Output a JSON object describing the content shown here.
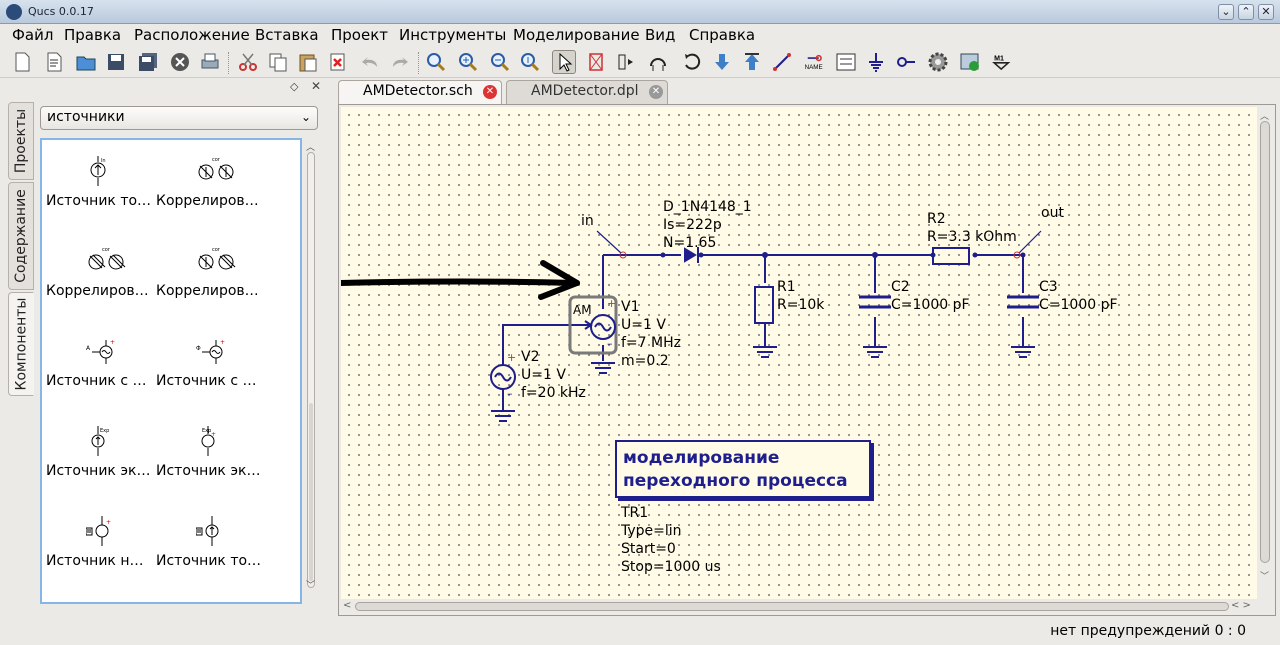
{
  "window": {
    "title": "Qucs 0.0.17",
    "controls": [
      "⌄",
      "⌃",
      "✕"
    ]
  },
  "menubar": {
    "items": [
      {
        "label": "Файл"
      },
      {
        "label": "Правка"
      },
      {
        "label": "Расположение"
      },
      {
        "label": "Вставка"
      },
      {
        "label": "Проект"
      },
      {
        "label": "Инструменты"
      },
      {
        "label": "Моделирование"
      },
      {
        "label": "Вид"
      },
      {
        "label": "Справка"
      }
    ]
  },
  "toolbar": {
    "icons": [
      "new-file-icon",
      "new-text-icon",
      "open-icon",
      "save-icon",
      "save-all-icon",
      "close-file-icon",
      "print-icon",
      "cut-icon",
      "copy-icon",
      "paste-icon",
      "delete-icon",
      "undo-icon",
      "redo-icon",
      "zoom-fit-icon",
      "zoom-in-icon",
      "zoom-out-icon",
      "zoom-1-icon",
      "select-icon",
      "deactivate-icon",
      "mirror-icon",
      "rotate-label-icon",
      "rotate-icon",
      "move-down-icon",
      "move-up-icon",
      "wire-icon",
      "name-icon",
      "equation-icon",
      "ground-icon",
      "port-icon",
      "simulate-icon",
      "display-icon",
      "marker-icon"
    ],
    "name_label": "NAME",
    "marker_label": "M1"
  },
  "dock": {
    "vertical_tabs": [
      {
        "label": "Проекты"
      },
      {
        "label": "Содержание"
      },
      {
        "label": "Компоненты"
      }
    ],
    "category": "источники",
    "components": [
      {
        "label": "Источник то…",
        "icon": "dc-current-source-icon"
      },
      {
        "label": "Коррелиров…",
        "icon": "correlated-current-source-icon"
      },
      {
        "label": "Коррелиров…",
        "icon": "correlated-voltage-source-icon"
      },
      {
        "label": "Коррелиров…",
        "icon": "correlated-mixed-source-icon"
      },
      {
        "label": "Источник с …",
        "icon": "am-source-icon"
      },
      {
        "label": "Источник с …",
        "icon": "pm-source-icon"
      },
      {
        "label": "Источник эк…",
        "icon": "exp-current-source-icon"
      },
      {
        "label": "Источник эк…",
        "icon": "exp-voltage-source-icon"
      },
      {
        "label": "Источник н…",
        "icon": "file-voltage-source-icon"
      },
      {
        "label": "Источник то…",
        "icon": "file-current-source-icon"
      }
    ]
  },
  "tabs": [
    {
      "label": "AMDetector.sch",
      "active": true
    },
    {
      "label": "AMDetector.dpl",
      "active": false
    }
  ],
  "schematic": {
    "labels": {
      "in": "in",
      "out": "out",
      "diode": [
        "D_1N4148_1",
        "Is=222p",
        "N=1.65"
      ],
      "r1": [
        "R1",
        "R=10k"
      ],
      "r2": [
        "R2",
        "R=3.3 kOhm"
      ],
      "c2": [
        "C2",
        "C=1000 pF"
      ],
      "c3": [
        "C3",
        "C=1000 pF"
      ],
      "v1": [
        "V1",
        "U=1 V",
        "f=7 MHz",
        "m=0.2"
      ],
      "v1_tag": "AM",
      "v2": [
        "V2",
        "U=1 V",
        "f=20 kHz"
      ],
      "sim_title": [
        "моделирование",
        "переходного процесса"
      ],
      "sim_params": [
        "TR1",
        "Type=lin",
        "Start=0",
        "Stop=1000 us"
      ]
    }
  },
  "status": {
    "text": "нет предупреждений 0 : 0"
  },
  "colors": {
    "wire": "#1e1e8c",
    "canvas": "#fffbe6",
    "selection": "#86b6e6",
    "tab_close_active": "#d33"
  }
}
